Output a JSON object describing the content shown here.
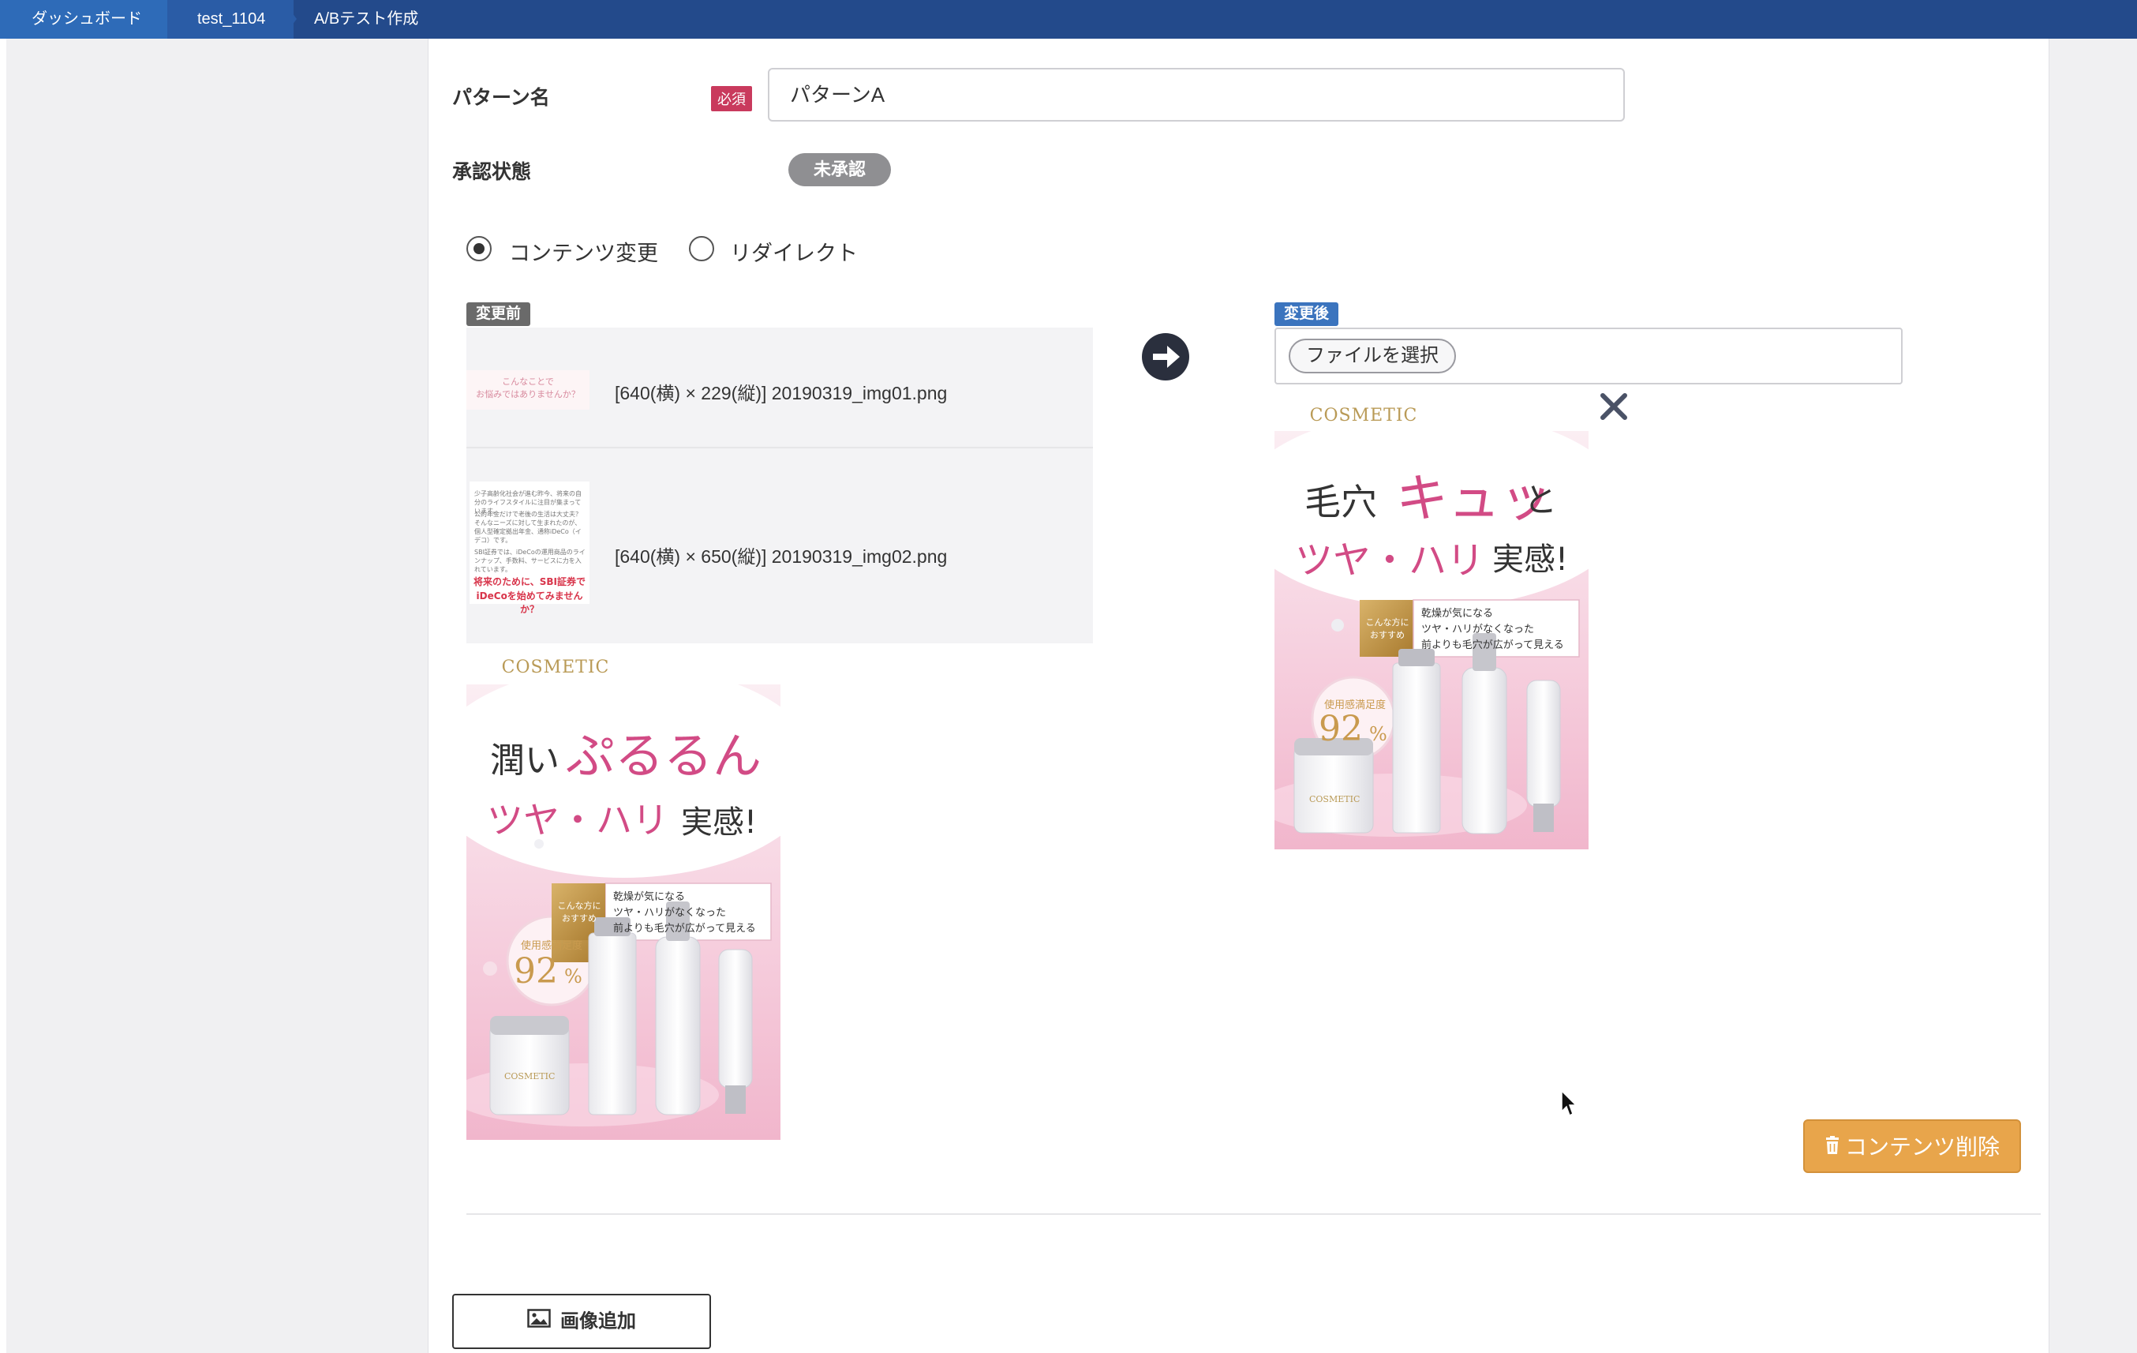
{
  "breadcrumb": {
    "items": [
      "ダッシュボード",
      "test_1104",
      "A/Bテスト作成"
    ]
  },
  "form": {
    "pattern_name_label": "パターン名",
    "required_badge": "必須",
    "pattern_name_value": "パターンA",
    "approval_label": "承認状態",
    "approval_status": "未承認"
  },
  "mode": {
    "options": [
      "コンテンツ変更",
      "リダイレクト"
    ],
    "selected": "コンテンツ変更"
  },
  "before": {
    "tag": "変更前",
    "files": [
      "[640(横) × 229(縦)] 20190319_img01.png",
      "[640(横) × 650(縦)] 20190319_img02.png"
    ],
    "thumb1": {
      "line1": "こんなことで",
      "line2": "お悩みではありませんか？"
    },
    "thumb2": {
      "body1": "少子高齢化社会が進む昨今、将来の自分のライフスタイルに注目が集まっています。",
      "body2": "公的年金だけで老後の生活は大丈夫？そんなニーズに対して生まれたのが、個人型確定拠出年金、通称iDeCo（イデコ）です。",
      "body3": "SBI証券では、iDeCoの運用商品のラインナップ、手数料、サービスに力を入れています。",
      "red1": "将来のために、SBI証券で",
      "red2": "iDeCoを始めてみませんか？"
    },
    "banner": {
      "brand": "COSMETIC",
      "headline_a": "潤い",
      "headline_b": "ぷるるん",
      "headline_c": "ツヤ・ハリ",
      "headline_d": "実感!",
      "badge": "こんな方に おすすめ",
      "checks": [
        "乾燥が気になる",
        "ツヤ・ハリがなくなった",
        "前よりも毛穴が広がって見える"
      ],
      "satisfaction_label": "使用感満足度",
      "satisfaction_value": "92",
      "unit": "%",
      "jar_label": "COSMETIC"
    }
  },
  "after": {
    "tag": "変更後",
    "file_button": "ファイルを選択",
    "banner": {
      "brand": "COSMETIC",
      "headline_a": "毛穴",
      "headline_b": "キュッ",
      "headline_c": "と",
      "headline_d": "ツヤ・ハリ",
      "headline_e": "実感!",
      "badge": "こんな方に おすすめ",
      "checks": [
        "乾燥が気になる",
        "ツヤ・ハリがなくなった",
        "前よりも毛穴が広がって見える"
      ],
      "satisfaction_label": "使用感満足度",
      "satisfaction_value": "92",
      "unit": "%",
      "jar_label": "COSMETIC"
    }
  },
  "actions": {
    "delete_content": "コンテンツ削除",
    "add_image": "画像追加"
  },
  "icons": {
    "arrow": "arrow-right-circle-icon",
    "close": "close-icon",
    "trash": "trash-icon",
    "image": "image-icon"
  },
  "colors": {
    "header": "#234a8b",
    "required": "#c93a5d",
    "approval_badge": "#8f8f92",
    "delete_button": "#e8a54b",
    "after_tag": "#3b74be",
    "before_tag": "#6a6a6a"
  }
}
